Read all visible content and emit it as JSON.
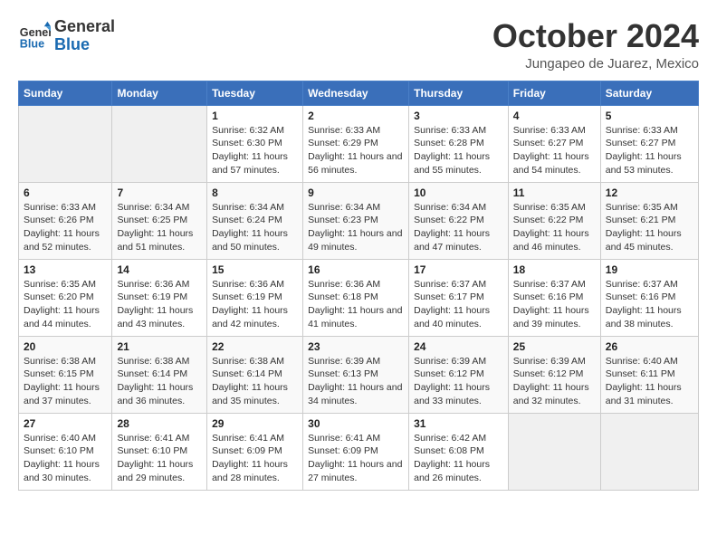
{
  "header": {
    "logo_line1": "General",
    "logo_line2": "Blue",
    "month": "October 2024",
    "location": "Jungapeo de Juarez, Mexico"
  },
  "days_of_week": [
    "Sunday",
    "Monday",
    "Tuesday",
    "Wednesday",
    "Thursday",
    "Friday",
    "Saturday"
  ],
  "weeks": [
    [
      {
        "day": "",
        "detail": ""
      },
      {
        "day": "",
        "detail": ""
      },
      {
        "day": "1",
        "detail": "Sunrise: 6:32 AM\nSunset: 6:30 PM\nDaylight: 11 hours and 57 minutes."
      },
      {
        "day": "2",
        "detail": "Sunrise: 6:33 AM\nSunset: 6:29 PM\nDaylight: 11 hours and 56 minutes."
      },
      {
        "day": "3",
        "detail": "Sunrise: 6:33 AM\nSunset: 6:28 PM\nDaylight: 11 hours and 55 minutes."
      },
      {
        "day": "4",
        "detail": "Sunrise: 6:33 AM\nSunset: 6:27 PM\nDaylight: 11 hours and 54 minutes."
      },
      {
        "day": "5",
        "detail": "Sunrise: 6:33 AM\nSunset: 6:27 PM\nDaylight: 11 hours and 53 minutes."
      }
    ],
    [
      {
        "day": "6",
        "detail": "Sunrise: 6:33 AM\nSunset: 6:26 PM\nDaylight: 11 hours and 52 minutes."
      },
      {
        "day": "7",
        "detail": "Sunrise: 6:34 AM\nSunset: 6:25 PM\nDaylight: 11 hours and 51 minutes."
      },
      {
        "day": "8",
        "detail": "Sunrise: 6:34 AM\nSunset: 6:24 PM\nDaylight: 11 hours and 50 minutes."
      },
      {
        "day": "9",
        "detail": "Sunrise: 6:34 AM\nSunset: 6:23 PM\nDaylight: 11 hours and 49 minutes."
      },
      {
        "day": "10",
        "detail": "Sunrise: 6:34 AM\nSunset: 6:22 PM\nDaylight: 11 hours and 47 minutes."
      },
      {
        "day": "11",
        "detail": "Sunrise: 6:35 AM\nSunset: 6:22 PM\nDaylight: 11 hours and 46 minutes."
      },
      {
        "day": "12",
        "detail": "Sunrise: 6:35 AM\nSunset: 6:21 PM\nDaylight: 11 hours and 45 minutes."
      }
    ],
    [
      {
        "day": "13",
        "detail": "Sunrise: 6:35 AM\nSunset: 6:20 PM\nDaylight: 11 hours and 44 minutes."
      },
      {
        "day": "14",
        "detail": "Sunrise: 6:36 AM\nSunset: 6:19 PM\nDaylight: 11 hours and 43 minutes."
      },
      {
        "day": "15",
        "detail": "Sunrise: 6:36 AM\nSunset: 6:19 PM\nDaylight: 11 hours and 42 minutes."
      },
      {
        "day": "16",
        "detail": "Sunrise: 6:36 AM\nSunset: 6:18 PM\nDaylight: 11 hours and 41 minutes."
      },
      {
        "day": "17",
        "detail": "Sunrise: 6:37 AM\nSunset: 6:17 PM\nDaylight: 11 hours and 40 minutes."
      },
      {
        "day": "18",
        "detail": "Sunrise: 6:37 AM\nSunset: 6:16 PM\nDaylight: 11 hours and 39 minutes."
      },
      {
        "day": "19",
        "detail": "Sunrise: 6:37 AM\nSunset: 6:16 PM\nDaylight: 11 hours and 38 minutes."
      }
    ],
    [
      {
        "day": "20",
        "detail": "Sunrise: 6:38 AM\nSunset: 6:15 PM\nDaylight: 11 hours and 37 minutes."
      },
      {
        "day": "21",
        "detail": "Sunrise: 6:38 AM\nSunset: 6:14 PM\nDaylight: 11 hours and 36 minutes."
      },
      {
        "day": "22",
        "detail": "Sunrise: 6:38 AM\nSunset: 6:14 PM\nDaylight: 11 hours and 35 minutes."
      },
      {
        "day": "23",
        "detail": "Sunrise: 6:39 AM\nSunset: 6:13 PM\nDaylight: 11 hours and 34 minutes."
      },
      {
        "day": "24",
        "detail": "Sunrise: 6:39 AM\nSunset: 6:12 PM\nDaylight: 11 hours and 33 minutes."
      },
      {
        "day": "25",
        "detail": "Sunrise: 6:39 AM\nSunset: 6:12 PM\nDaylight: 11 hours and 32 minutes."
      },
      {
        "day": "26",
        "detail": "Sunrise: 6:40 AM\nSunset: 6:11 PM\nDaylight: 11 hours and 31 minutes."
      }
    ],
    [
      {
        "day": "27",
        "detail": "Sunrise: 6:40 AM\nSunset: 6:10 PM\nDaylight: 11 hours and 30 minutes."
      },
      {
        "day": "28",
        "detail": "Sunrise: 6:41 AM\nSunset: 6:10 PM\nDaylight: 11 hours and 29 minutes."
      },
      {
        "day": "29",
        "detail": "Sunrise: 6:41 AM\nSunset: 6:09 PM\nDaylight: 11 hours and 28 minutes."
      },
      {
        "day": "30",
        "detail": "Sunrise: 6:41 AM\nSunset: 6:09 PM\nDaylight: 11 hours and 27 minutes."
      },
      {
        "day": "31",
        "detail": "Sunrise: 6:42 AM\nSunset: 6:08 PM\nDaylight: 11 hours and 26 minutes."
      },
      {
        "day": "",
        "detail": ""
      },
      {
        "day": "",
        "detail": ""
      }
    ]
  ]
}
